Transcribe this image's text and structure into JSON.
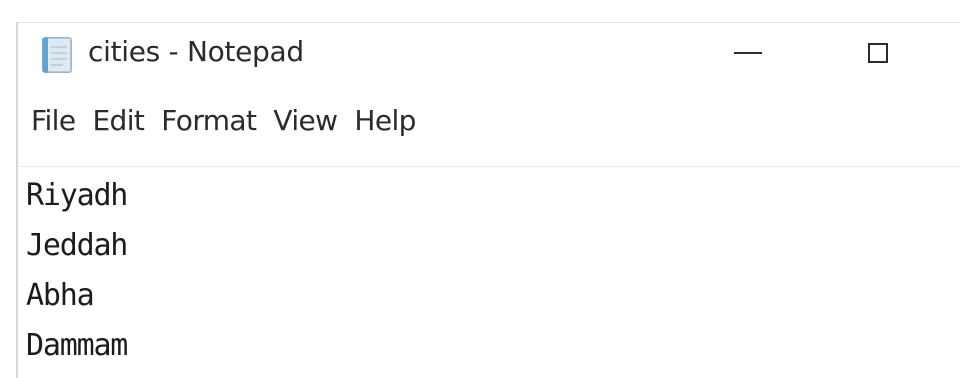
{
  "window": {
    "title": "cities - Notepad",
    "icon": "notepad-icon",
    "controls": {
      "minimize_icon": "minimize-icon",
      "maximize_icon": "maximize-icon"
    }
  },
  "menu": {
    "items": [
      {
        "label": "File"
      },
      {
        "label": "Edit"
      },
      {
        "label": "Format"
      },
      {
        "label": "View"
      },
      {
        "label": "Help"
      }
    ]
  },
  "document": {
    "lines": [
      "Riyadh",
      "Jeddah",
      "Abha",
      "Dammam"
    ]
  },
  "colors": {
    "text": "#2b2b2b",
    "background": "#ffffff",
    "icon_blue": "#5aa6d6",
    "icon_paper": "#e8eef2"
  }
}
